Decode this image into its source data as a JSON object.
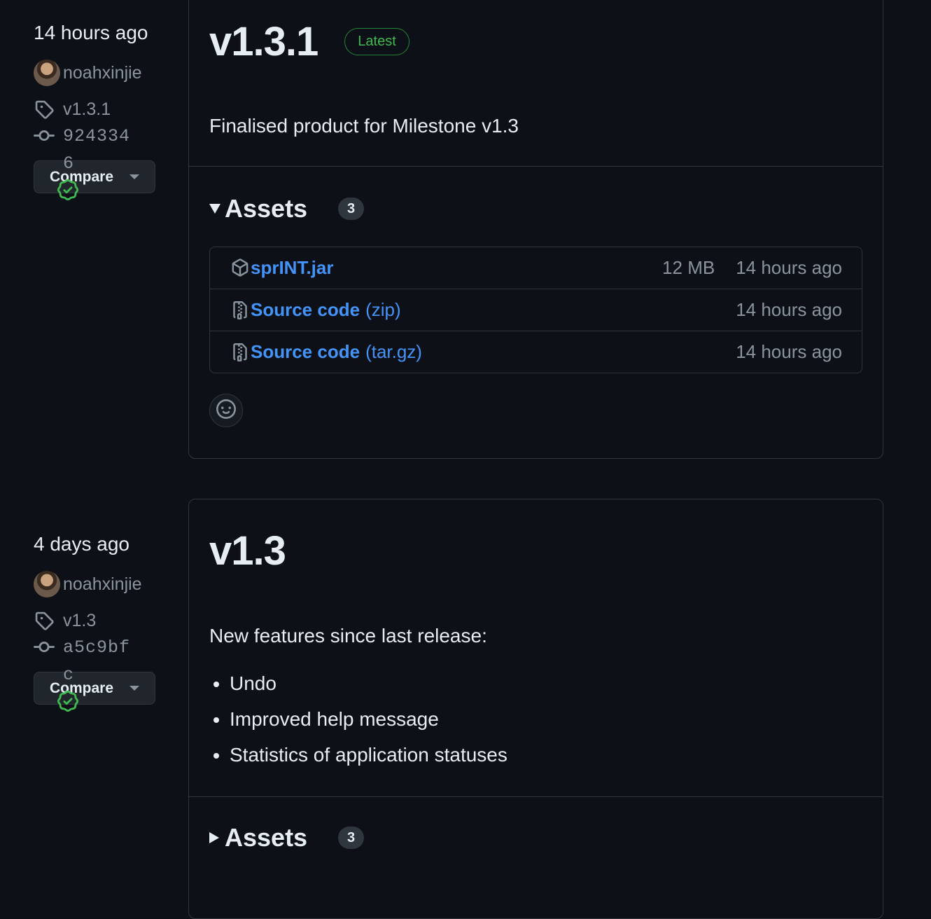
{
  "releases": [
    {
      "sidebar": {
        "time": "14 hours ago",
        "author": "noahxinjie",
        "tag": "v1.3.1",
        "commit": "9243346",
        "compare_label": "Compare"
      },
      "version": "v1.3.1",
      "badge": "Latest",
      "description": "Finalised product for Milestone v1.3",
      "assets_title": "Assets",
      "assets_count": "3",
      "assets": [
        {
          "name": "sprINT.jar",
          "ext": "",
          "size": "12 MB",
          "time": "14 hours ago",
          "icon": "package-icon"
        },
        {
          "name": "Source code",
          "ext": "(zip)",
          "size": "",
          "time": "14 hours ago",
          "icon": "file-zip-icon"
        },
        {
          "name": "Source code",
          "ext": "(tar.gz)",
          "size": "",
          "time": "14 hours ago",
          "icon": "file-zip-icon"
        }
      ]
    },
    {
      "sidebar": {
        "time": "4 days ago",
        "author": "noahxinjie",
        "tag": "v1.3",
        "commit": "a5c9bfc",
        "compare_label": "Compare"
      },
      "version": "v1.3",
      "description": "New features since last release:",
      "features": [
        "Undo",
        "Improved help message",
        "Statistics of application statuses"
      ],
      "assets_title": "Assets",
      "assets_count": "3"
    }
  ],
  "colors": {
    "background": "#0d1117",
    "link": "#4493f8",
    "success": "#3fb950",
    "muted": "#8b949e",
    "border": "#30363d"
  }
}
